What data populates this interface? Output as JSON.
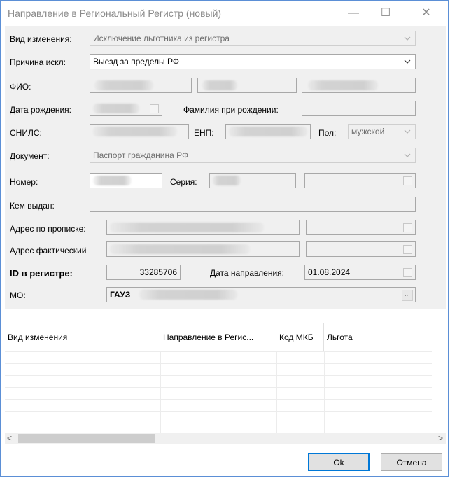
{
  "window": {
    "title": "Направление в Региональный Регистр (новый)",
    "minimize_symbol": "—",
    "maximize_symbol": "☐",
    "close_symbol": "✕"
  },
  "form": {
    "change_type": {
      "label": "Вид изменения:",
      "value": "Исключение льготника из регистра"
    },
    "exclusion_reason": {
      "label": "Причина искл:",
      "value": "Выезд за пределы РФ"
    },
    "fio": {
      "label": "ФИО:"
    },
    "birth_date": {
      "label": "Дата рождения:"
    },
    "birth_surname": {
      "label": "Фамилия при рождении:"
    },
    "snils": {
      "label": "СНИЛС:"
    },
    "enp": {
      "label": "ЕНП:"
    },
    "sex": {
      "label": "Пол:",
      "value": "мужской"
    },
    "document": {
      "label": "Документ:",
      "value": "Паспорт гражданина РФ"
    },
    "number": {
      "label": "Номер:"
    },
    "series": {
      "label": "Серия:"
    },
    "issued_by": {
      "label": "Кем выдан:"
    },
    "reg_address": {
      "label": "Адрес по прописке:"
    },
    "fact_address": {
      "label": "Адрес фактический"
    },
    "registry_id": {
      "label": "ID в регистре:",
      "value": "33285706"
    },
    "direction_date": {
      "label": "Дата направления:",
      "value": "01.08.2024"
    },
    "mo": {
      "label": "МО:",
      "value": "ГАУЗ",
      "button": "..."
    }
  },
  "grid": {
    "columns": [
      "Вид изменения",
      "Направление в Регис...",
      "Код МКБ",
      "Льгота"
    ]
  },
  "scroll": {
    "left": "<",
    "right": ">"
  },
  "buttons": {
    "ok": "Ok",
    "cancel": "Отмена"
  },
  "colors": {
    "accent": "#0078d7",
    "window_border": "#5b8fd6",
    "form_bg": "#f0f0f0"
  }
}
